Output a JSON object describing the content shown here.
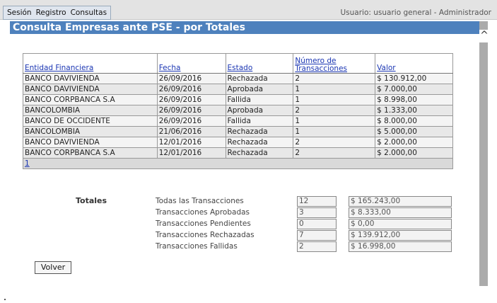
{
  "menu": {
    "items": [
      "Sesión",
      "Registro",
      "Consultas"
    ]
  },
  "user_info": "Usuario: usuario general - Administrador",
  "page_title": "Consulta Empresas ante PSE - por Totales",
  "table": {
    "headers": [
      "Entidad Financiera",
      "Fecha",
      "Estado",
      "Número de Transacciones",
      "Valor"
    ],
    "rows": [
      [
        "BANCO DAVIVIENDA",
        "26/09/2016",
        "Rechazada",
        "2",
        "$ 130.912,00"
      ],
      [
        "BANCO DAVIVIENDA",
        "26/09/2016",
        "Aprobada",
        "1",
        "$ 7.000,00"
      ],
      [
        "BANCO CORPBANCA S.A",
        "26/09/2016",
        "Fallida",
        "1",
        "$ 8.998,00"
      ],
      [
        "BANCOLOMBIA",
        "26/09/2016",
        "Aprobada",
        "2",
        "$ 1.333,00"
      ],
      [
        "BANCO DE OCCIDENTE",
        "26/09/2016",
        "Fallida",
        "1",
        "$ 8.000,00"
      ],
      [
        "BANCOLOMBIA",
        "21/06/2016",
        "Rechazada",
        "1",
        "$ 5.000,00"
      ],
      [
        "BANCO DAVIVIENDA",
        "12/01/2016",
        "Rechazada",
        "2",
        "$ 2.000,00"
      ],
      [
        "BANCO CORPBANCA S.A",
        "12/01/2016",
        "Rechazada",
        "2",
        "$ 2.000,00"
      ]
    ],
    "pager": "1"
  },
  "totals": {
    "label": "Totales",
    "rows": [
      {
        "name": "Todas las Transacciones",
        "count": "12",
        "value": "$ 165.243,00"
      },
      {
        "name": "Transacciones Aprobadas",
        "count": "3",
        "value": "$ 8.333,00"
      },
      {
        "name": "Transacciones Pendientes",
        "count": "0",
        "value": "$ 0,00"
      },
      {
        "name": "Transacciones Rechazadas",
        "count": "7",
        "value": "$ 139.912,00"
      },
      {
        "name": "Transacciones Fallidas",
        "count": "2",
        "value": "$ 16.998,00"
      }
    ]
  },
  "back_button": "Volver"
}
